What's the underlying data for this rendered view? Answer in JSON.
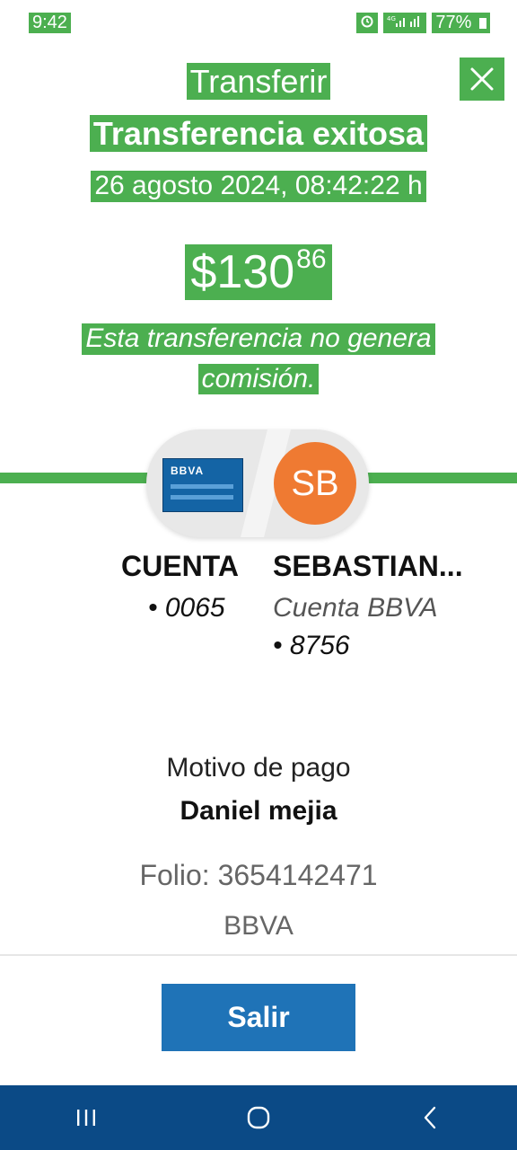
{
  "status_bar": {
    "time": "9:42",
    "indicators": [
      "alarm-icon",
      "4g-icon",
      "signal-icon",
      "signal-icon"
    ],
    "battery": "77%"
  },
  "header": {
    "title": "Transferir",
    "status": "Transferencia exitosa",
    "datetime": "26 agosto 2024, 08:42:22 h",
    "close_icon": "close-icon"
  },
  "amount": {
    "currency": "$",
    "integer": "130",
    "cents": "86"
  },
  "commission_note": {
    "line1": "Esta transferencia no genera",
    "line2": "comisión."
  },
  "card": {
    "logo": "BBVA",
    "avatar_initials": "SB"
  },
  "origin": {
    "name": "CUENTA",
    "number": "• 0065"
  },
  "destination": {
    "name": "SEBASTIAN...",
    "bank": "Cuenta BBVA",
    "number": "• 8756"
  },
  "details": {
    "motivo_label": "Motivo de pago",
    "motivo_value": "Daniel mejia",
    "folio": "Folio: 3654142471",
    "bank": "BBVA"
  },
  "actions": {
    "exit_label": "Salir"
  },
  "colors": {
    "green": "#4caf50",
    "button_blue": "#1f73b7",
    "navbar_blue": "#0b4a86",
    "avatar_orange": "#ef7a32"
  }
}
